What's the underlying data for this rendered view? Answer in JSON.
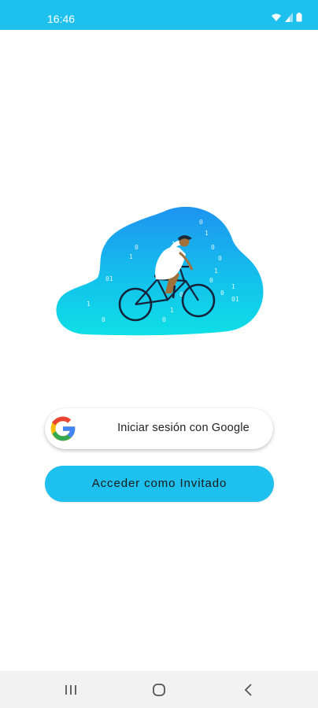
{
  "status_bar": {
    "time": "16:46",
    "icons": [
      "wifi-icon",
      "signal-icon",
      "battery-icon"
    ],
    "background_color": "#1ec0ee"
  },
  "hero": {
    "image": "cyclist-cloud-illustration",
    "digits": [
      "0",
      "1",
      "0",
      "1",
      "01",
      "1",
      "0",
      "0",
      "1",
      "0",
      "0",
      "1",
      "0",
      "1",
      "0",
      "01",
      "0",
      "1"
    ]
  },
  "login": {
    "google_button_label": "Iniciar sesión con Google",
    "google_icon": "google-logo-icon",
    "guest_button_label": "Acceder como Invitado",
    "accent_color": "#1ec0ee"
  },
  "nav_bar": {
    "items": [
      "recent-apps-icon",
      "home-icon",
      "back-icon"
    ]
  }
}
